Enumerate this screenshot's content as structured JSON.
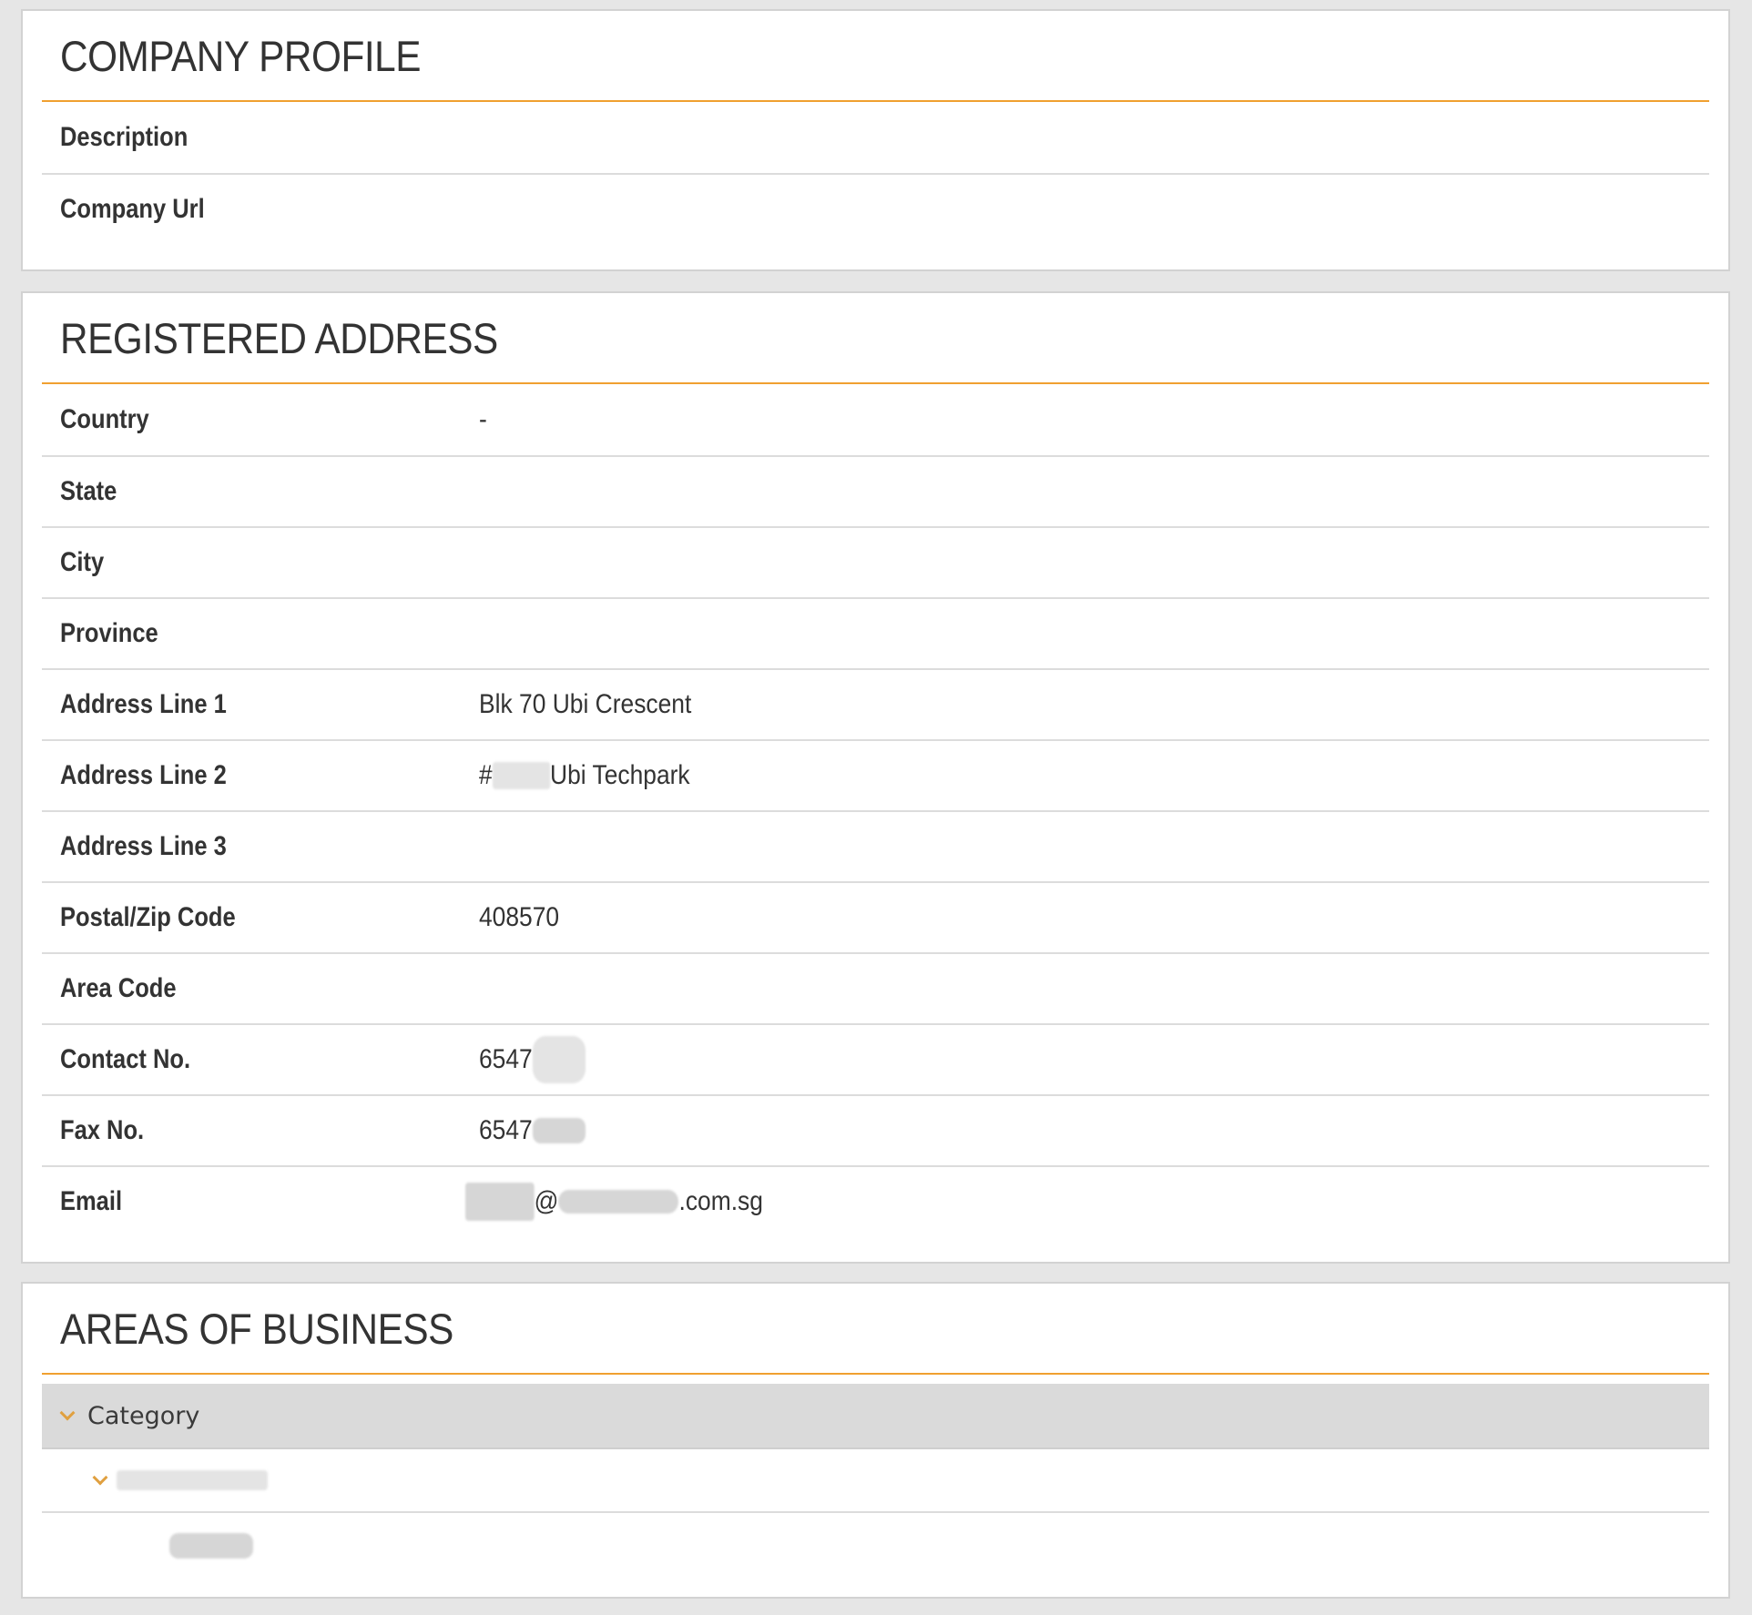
{
  "company_profile": {
    "title": "COMPANY PROFILE",
    "fields": [
      {
        "label": "Description",
        "value": ""
      },
      {
        "label": "Company Url",
        "value": ""
      }
    ]
  },
  "registered_address": {
    "title": "REGISTERED ADDRESS",
    "fields": [
      {
        "label": "Country",
        "value": "-"
      },
      {
        "label": "State",
        "value": ""
      },
      {
        "label": "City",
        "value": ""
      },
      {
        "label": "Province",
        "value": ""
      },
      {
        "label": "Address Line 1",
        "value": "Blk 70 Ubi Crescent"
      },
      {
        "label": "Address Line 2",
        "value_prefix": "#",
        "value_suffix": "Ubi Techpark"
      },
      {
        "label": "Address Line 3",
        "value": ""
      },
      {
        "label": "Postal/Zip Code",
        "value": "408570"
      },
      {
        "label": "Area Code",
        "value": ""
      },
      {
        "label": "Contact No.",
        "value_prefix": "6547"
      },
      {
        "label": "Fax No.",
        "value_prefix": "6547"
      },
      {
        "label": "Email",
        "value_at": "@",
        "value_suffix": ".com.sg"
      }
    ]
  },
  "areas_of_business": {
    "title": "AREAS OF BUSINESS",
    "category_label": "Category"
  },
  "colors": {
    "accent": "#f0a030",
    "page_bg": "#e6e6e6",
    "panel_bg": "#ffffff",
    "category_bar_bg": "#dadada"
  },
  "icons": {
    "expand": "chevron-down-icon"
  }
}
